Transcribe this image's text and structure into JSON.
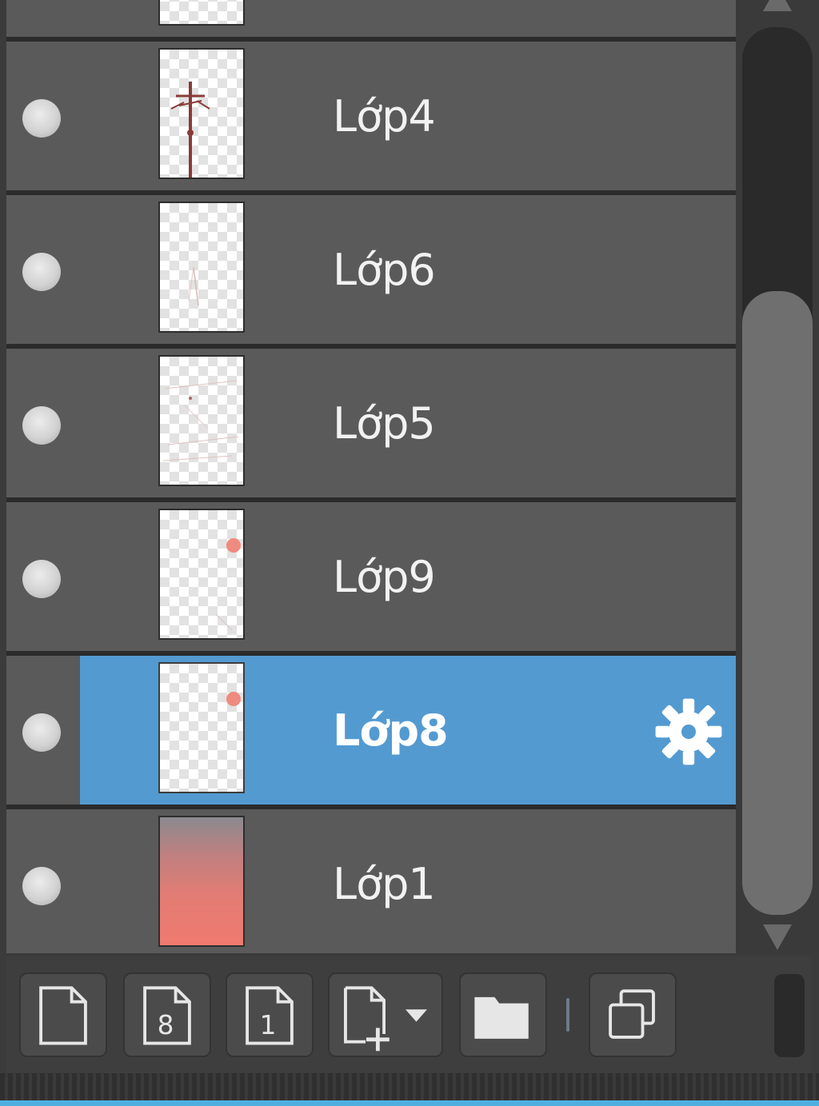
{
  "layers": [
    {
      "label": "Lớp4",
      "selected": false,
      "thumbnail": "tree-sketch"
    },
    {
      "label": "Lớp6",
      "selected": false,
      "thumbnail": "faint-line"
    },
    {
      "label": "Lớp5",
      "selected": false,
      "thumbnail": "faint-sketch"
    },
    {
      "label": "Lớp9",
      "selected": false,
      "thumbnail": "sun-dot"
    },
    {
      "label": "Lớp8",
      "selected": true,
      "thumbnail": "sun-dot"
    },
    {
      "label": "Lớp1",
      "selected": false,
      "thumbnail": "sunset-gradient"
    }
  ],
  "toolbar": {
    "buttons": [
      {
        "icon": "new-layer-icon"
      },
      {
        "icon": "new-8bit-layer-icon",
        "glyph": "8"
      },
      {
        "icon": "new-1bit-layer-icon",
        "glyph": "1"
      },
      {
        "icon": "add-layer-dropdown-icon"
      },
      {
        "icon": "folder-icon"
      },
      {
        "icon": "duplicate-layer-icon"
      }
    ]
  },
  "colors": {
    "row_bg": "#5a5a5a",
    "selected_bg": "#539ad1",
    "accent_line": "#4fb0e0"
  }
}
